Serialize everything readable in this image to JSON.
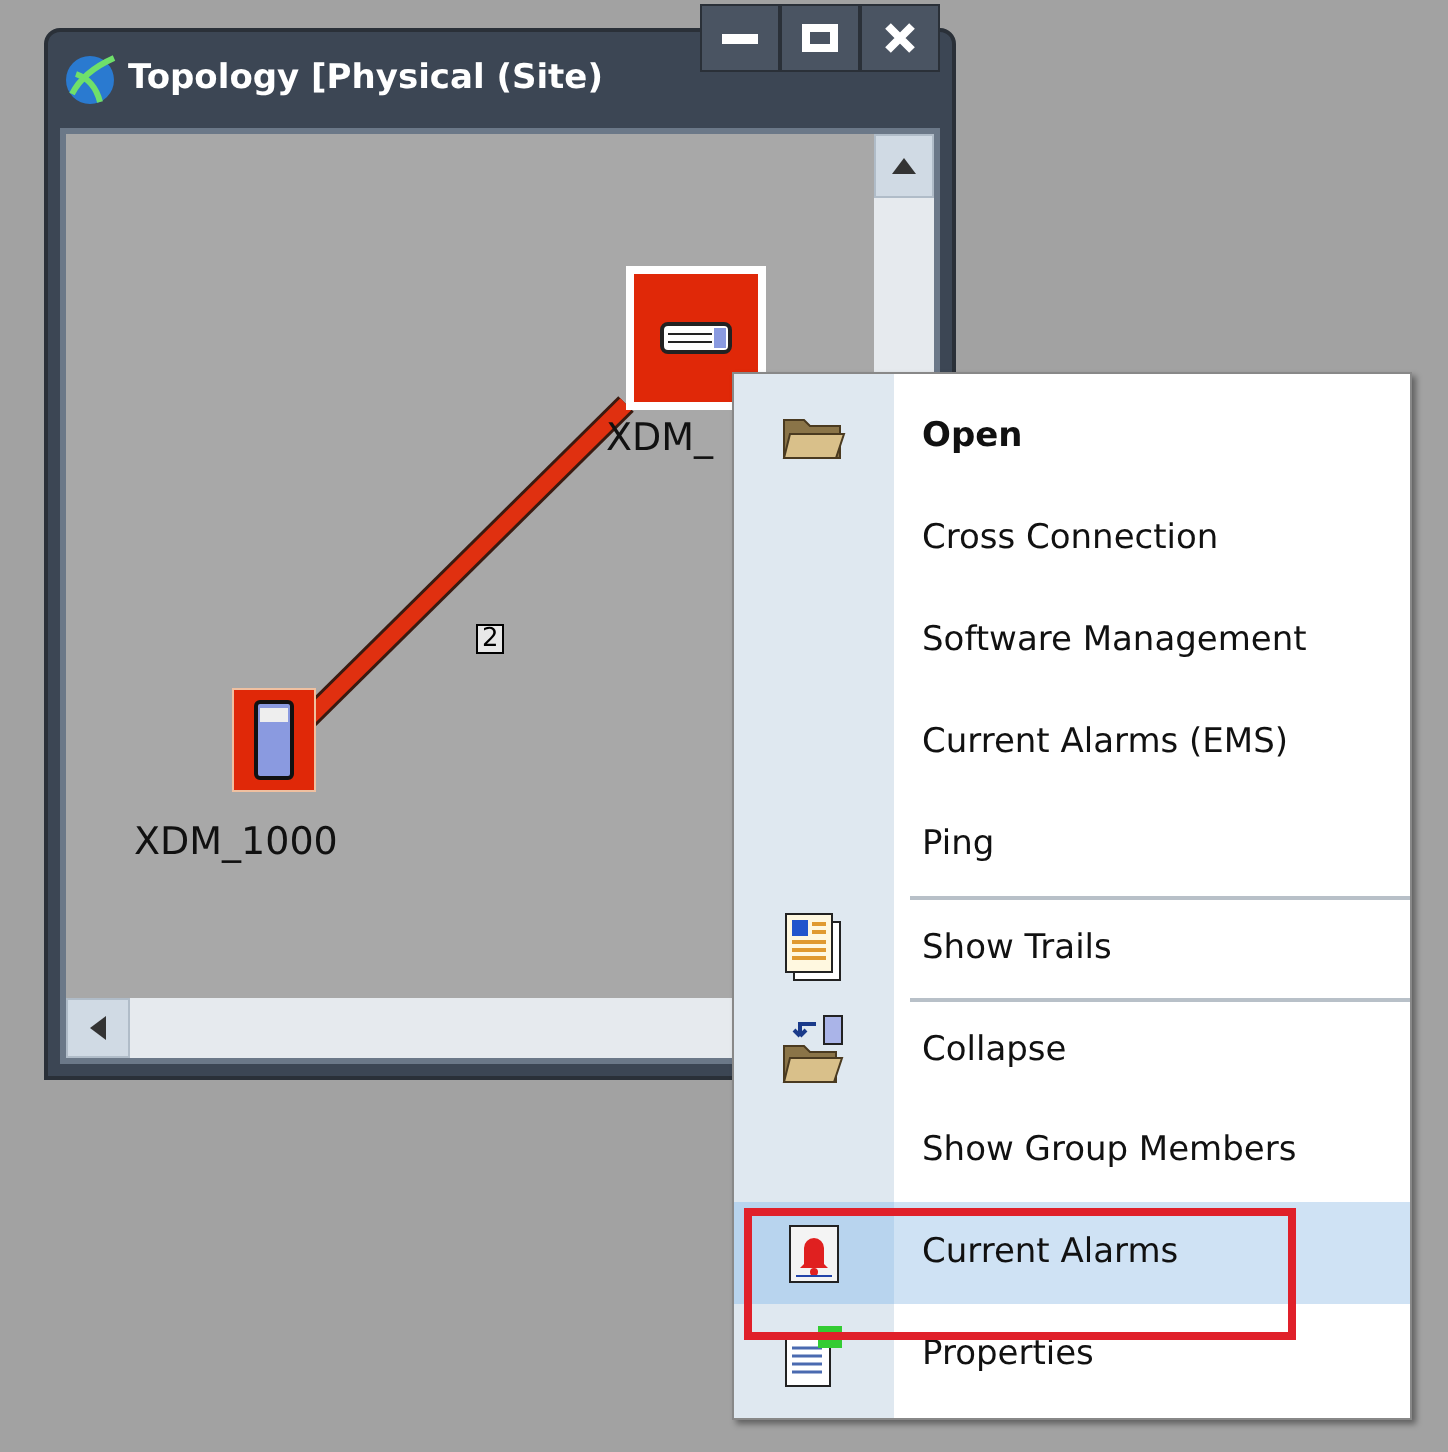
{
  "window": {
    "title": "Topology [Physical (Site)"
  },
  "topology": {
    "nodes": [
      {
        "label": "XDM_"
      },
      {
        "label": "XDM_1000"
      }
    ],
    "link": {
      "label": "2"
    }
  },
  "context_menu": {
    "items": [
      {
        "label": "Open",
        "bold": true,
        "separator_before": false,
        "selected": false
      },
      {
        "label": "Cross Connection",
        "bold": false,
        "separator_before": false,
        "selected": false
      },
      {
        "label": "Software Management",
        "bold": false,
        "separator_before": false,
        "selected": false
      },
      {
        "label": "Current Alarms (EMS)",
        "bold": false,
        "separator_before": false,
        "selected": false
      },
      {
        "label": "Ping",
        "bold": false,
        "separator_before": false,
        "selected": false
      },
      {
        "label": "Show Trails",
        "bold": false,
        "separator_before": true,
        "selected": false
      },
      {
        "label": "Collapse",
        "bold": false,
        "separator_before": true,
        "selected": false
      },
      {
        "label": "Show Group Members",
        "bold": false,
        "separator_before": false,
        "selected": false
      },
      {
        "label": "Current Alarms",
        "bold": false,
        "separator_before": false,
        "selected": true
      },
      {
        "label": "Properties",
        "bold": false,
        "separator_before": false,
        "selected": false
      }
    ]
  }
}
